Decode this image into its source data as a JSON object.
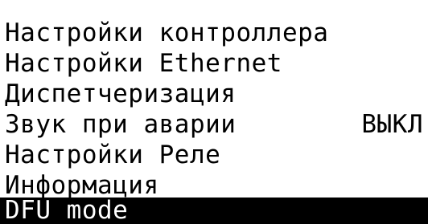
{
  "menu": {
    "items": [
      {
        "label": "Настройки контроллера",
        "value": ""
      },
      {
        "label": "Настройки Ethernet",
        "value": ""
      },
      {
        "label": "Диспетчеризация",
        "value": ""
      },
      {
        "label": "Звук при аварии",
        "value": "ВЫКЛ"
      },
      {
        "label": "Настройки Реле",
        "value": ""
      },
      {
        "label": "Информация",
        "value": ""
      },
      {
        "label": "DFU mode",
        "value": ""
      }
    ],
    "selected_index": 6
  },
  "colors": {
    "background": "#ffffff",
    "text": "#000000",
    "selection_bg": "#000000",
    "selection_text": "#ffffff"
  }
}
